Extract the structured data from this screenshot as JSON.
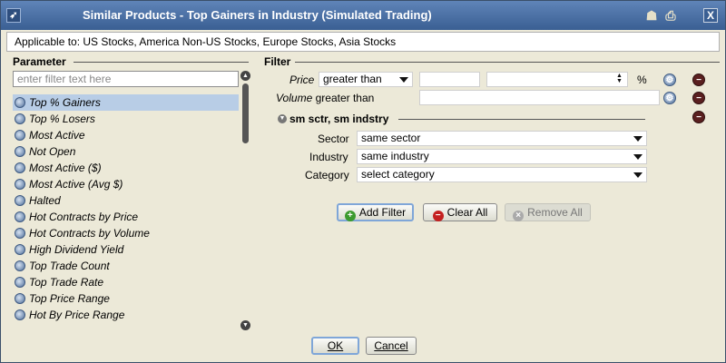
{
  "window": {
    "title": "Similar Products - Top Gainers in Industry (Simulated Trading)",
    "close_label": "X"
  },
  "applicable_to": "Applicable to: US Stocks, America Non-US Stocks, Europe Stocks, Asia Stocks",
  "parameter": {
    "heading": "Parameter",
    "filter_placeholder": "enter filter text here",
    "items": [
      "Top % Gainers",
      "Top % Losers",
      "Most Active",
      "Not Open",
      "Most Active ($)",
      "Most Active (Avg $)",
      "Halted",
      "Hot Contracts by Price",
      "Hot Contracts by Volume",
      "High Dividend Yield",
      "Top Trade Count",
      "Top Trade Rate",
      "Top Price Range",
      "Hot By Price Range"
    ],
    "selected_index": 0
  },
  "filter": {
    "heading": "Filter",
    "price": {
      "label": "Price",
      "operator": "greater than",
      "value": "",
      "unit": "%"
    },
    "volume": {
      "label": "Volume",
      "operator": "greater than",
      "value": ""
    },
    "group": {
      "title": "sm sctr, sm indstry",
      "sector": {
        "label": "Sector",
        "value": "same sector"
      },
      "industry": {
        "label": "Industry",
        "value": "same industry"
      },
      "category": {
        "label": "Category",
        "value": "select category"
      }
    },
    "buttons": {
      "add": "Add Filter",
      "clear": "Clear All",
      "remove": "Remove All"
    }
  },
  "footer": {
    "ok": "OK",
    "cancel": "Cancel"
  }
}
